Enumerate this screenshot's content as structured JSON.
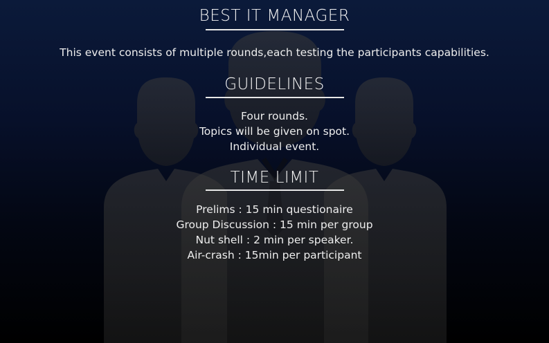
{
  "event": {
    "title": "BEST IT MANAGER",
    "description": "This event consists of multiple rounds,each testing the participants capabilities."
  },
  "guidelines": {
    "heading": "GUIDELINES",
    "items": [
      "Four rounds.",
      "Topics will be given on spot.",
      "Individual event."
    ]
  },
  "time_limit": {
    "heading": "TIME LIMIT",
    "items": [
      "Prelims : 15 min questionaire",
      "Group Discussion : 15 min per group",
      "Nut shell : 2 min per speaker.",
      "Air-crash : 15min per participant"
    ]
  },
  "background": {
    "icon": "group-of-people-icon",
    "gradient_top": "#0b1a3a",
    "gradient_bottom": "#000000",
    "silhouette_color": "#2a2a2a"
  }
}
